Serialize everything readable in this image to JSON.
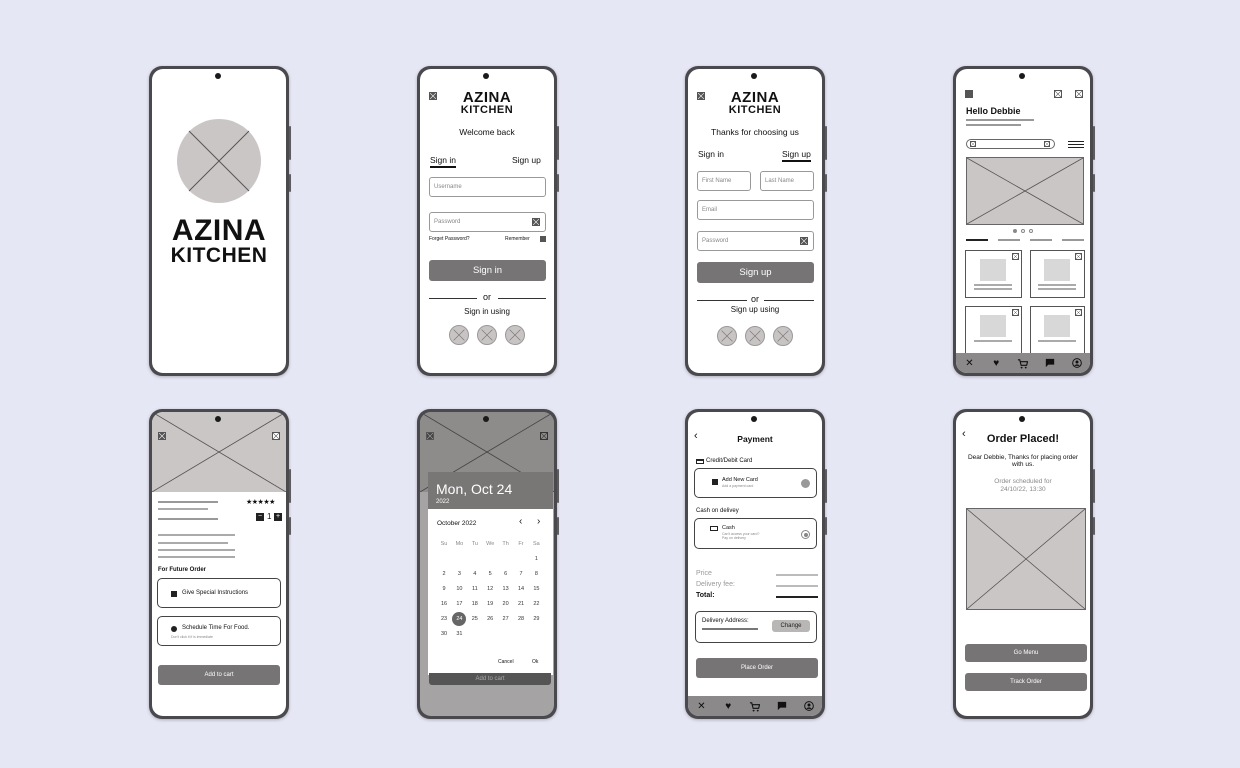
{
  "brand": {
    "line1": "AZINA",
    "line2": "KITCHEN"
  },
  "signin": {
    "welcome": "Welcome back",
    "tab_signin": "Sign in",
    "tab_signup": "Sign up",
    "username_ph": "Username",
    "password_ph": "Password",
    "forgot": "Forget Password?",
    "remember": "Remember",
    "button": "Sign in",
    "or": "or",
    "using": "Sign in using"
  },
  "signup": {
    "thanks": "Thanks for choosing us",
    "tab_signin": "Sign in",
    "tab_signup": "Sign up",
    "first_ph": "First Name",
    "last_ph": "Last  Name",
    "email_ph": "Email",
    "password_ph": "Password",
    "button": "Sign up",
    "or": "or",
    "using": "Sign up using"
  },
  "home": {
    "greeting": "Hello Debbie"
  },
  "product": {
    "stars": "★★★★★",
    "qty_minus": "−",
    "qty": "1",
    "qty_plus": "+",
    "future": "For Future Order",
    "special": "Give Special Instructions",
    "schedule": "Schedule Time For Food.",
    "schedule_sub": "Don't click it if is immediate",
    "add": "Add to cart"
  },
  "calendar": {
    "big_date": "Mon, Oct 24",
    "year": "2022",
    "month": "October 2022",
    "weekdays": [
      "Su",
      "Mo",
      "Tu",
      "We",
      "Th",
      "Fr",
      "Sa"
    ],
    "days": [
      "1",
      "2",
      "3",
      "4",
      "5",
      "6",
      "7",
      "8",
      "9",
      "10",
      "11",
      "12",
      "13",
      "14",
      "15",
      "16",
      "17",
      "18",
      "19",
      "20",
      "21",
      "22",
      "23",
      "24",
      "25",
      "26",
      "27",
      "28",
      "29",
      "30",
      "31"
    ],
    "cancel": "Cancel",
    "ok": "Ok",
    "behind": "Add to cart"
  },
  "payment": {
    "title": "Payment",
    "card_section": "Credit/Debit Card",
    "add_card": "Add New Card",
    "add_card_sub": "Add a payment card",
    "cod_section": "Cash on delivey",
    "cash": "Cash",
    "cash_sub1": "Can't access your card?",
    "cash_sub2": "Pay on delivery",
    "price": "Price",
    "fee": "Delivery fee:",
    "total": "Total:",
    "address": "Delivery Address:",
    "change": "Change",
    "place": "Place Order"
  },
  "order": {
    "title": "Order Placed!",
    "thanks": "Dear Debbie, Thanks for placing order with us.",
    "scheduled": "Order scheduled for",
    "datetime": "24/10/22, 13:30",
    "go_menu": "Go Menu",
    "track": "Track Order"
  },
  "nav_icons": [
    "fork-knife-icon",
    "heart-icon",
    "cart-icon",
    "chat-icon",
    "profile-icon"
  ],
  "colors": {
    "background": "#e6e7f5",
    "button": "#767474",
    "placeholder": "#cbc6c6",
    "navbar": "#8b8989"
  }
}
